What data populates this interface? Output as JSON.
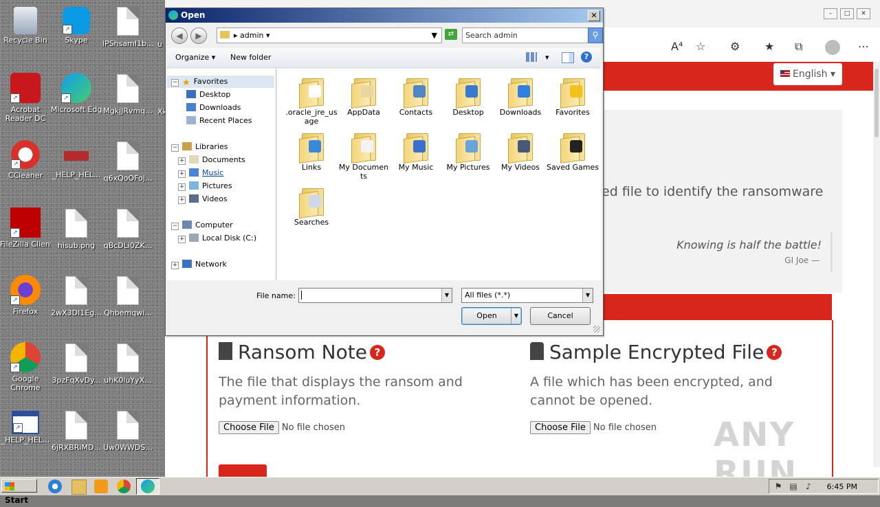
{
  "desktop": {
    "icons": [
      {
        "label": "Recycle Bin"
      },
      {
        "label": "Skype"
      },
      {
        "label": "lPShsamI1b..."
      },
      {
        "label": "Acrobat Reader DC"
      },
      {
        "label": "Microsoft Edge"
      },
      {
        "label": "MgkjJRvmq..."
      },
      {
        "label": "CCleaner"
      },
      {
        "label": "_HELP_HEL..."
      },
      {
        "label": "q6xQoOFoj..."
      },
      {
        "label": "FileZilla Client"
      },
      {
        "label": "hisub.png"
      },
      {
        "label": "qBcDLi0ZK..."
      },
      {
        "label": "Firefox"
      },
      {
        "label": "2wX3DI1Eg..."
      },
      {
        "label": "Qhbemqwi..."
      },
      {
        "label": "Google Chrome"
      },
      {
        "label": "3pzFqXvDy..."
      },
      {
        "label": "uhK0luYyX..."
      },
      {
        "label": "_HELP_HEL..."
      },
      {
        "label": "6jRXBRiMD..."
      },
      {
        "label": "Uw0WWDS..."
      }
    ],
    "edge_labels": [
      "u",
      "Xk"
    ]
  },
  "browser": {
    "language": "English",
    "identify_text": "ed file to identify the ransomware",
    "quote": "Knowing is half the battle!",
    "quote_by": "GI Joe —",
    "ransom_note": {
      "title": "Ransom Note",
      "description": "The file that displays the ransom and payment information.",
      "choose_label": "Choose File",
      "no_file": "No file chosen"
    },
    "sample_file": {
      "title": "Sample Encrypted File",
      "description": "A file which has been encrypted, and cannot be opened.",
      "choose_label": "Choose File",
      "no_file": "No file chosen"
    },
    "watermark": "ANY RUN",
    "accent_color": "#d9261c"
  },
  "dialog": {
    "title": "Open",
    "address": "admin",
    "search_placeholder": "Search admin",
    "organize_label": "Organize",
    "new_folder_label": "New folder",
    "nav": {
      "favorites": "Favorites",
      "desktop": "Desktop",
      "downloads": "Downloads",
      "recent_places": "Recent Places",
      "libraries": "Libraries",
      "documents": "Documents",
      "music": "Music",
      "pictures": "Pictures",
      "videos": "Videos",
      "computer": "Computer",
      "local_disk": "Local Disk (C:)",
      "network": "Network"
    },
    "files": [
      {
        "label": ".oracle_jre_usage"
      },
      {
        "label": "AppData"
      },
      {
        "label": "Contacts"
      },
      {
        "label": "Desktop"
      },
      {
        "label": "Downloads"
      },
      {
        "label": "Favorites"
      },
      {
        "label": "Links"
      },
      {
        "label": "My Documents"
      },
      {
        "label": "My Music"
      },
      {
        "label": "My Pictures"
      },
      {
        "label": "My Videos"
      },
      {
        "label": "Saved Games"
      },
      {
        "label": "Searches"
      }
    ],
    "file_name_label": "File name:",
    "file_name_value": "",
    "file_type": "All files (*.*)",
    "open_label": "Open",
    "cancel_label": "Cancel"
  },
  "taskbar": {
    "start_label": "Start",
    "clock": "6:45 PM"
  }
}
